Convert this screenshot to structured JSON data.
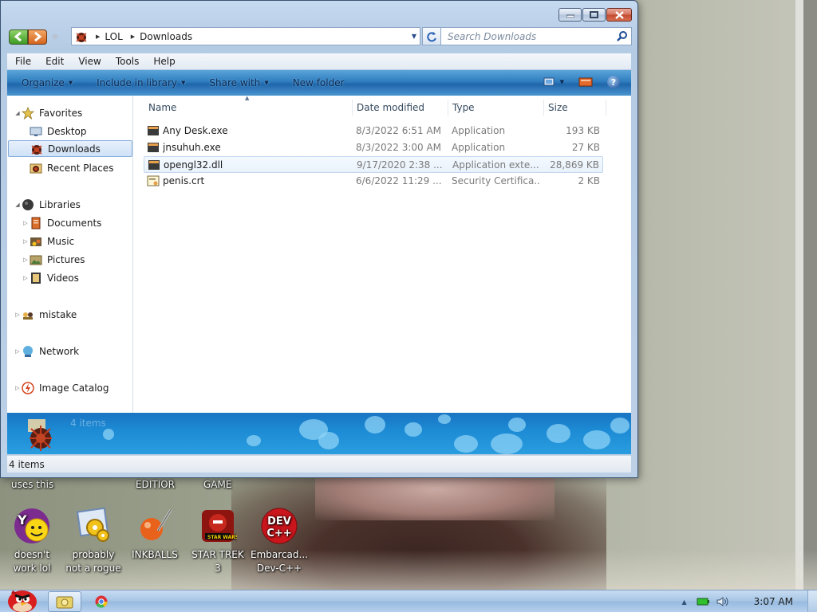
{
  "window": {
    "address": [
      "LOL",
      "Downloads"
    ],
    "search_placeholder": "Search Downloads",
    "menu": [
      "File",
      "Edit",
      "View",
      "Tools",
      "Help"
    ],
    "commands": [
      "Organize",
      "Include in library",
      "Share with",
      "New folder"
    ],
    "nav": {
      "favorites": "Favorites",
      "desktop": "Desktop",
      "downloads": "Downloads",
      "recent": "Recent Places",
      "libraries": "Libraries",
      "documents": "Documents",
      "music": "Music",
      "pictures": "Pictures",
      "videos": "Videos",
      "mistake": "mistake",
      "network": "Network",
      "image_catalog": "Image Catalog"
    },
    "columns": {
      "name": "Name",
      "date": "Date modified",
      "type": "Type",
      "size": "Size"
    },
    "files": [
      {
        "name": "Any Desk.exe",
        "date": "8/3/2022 6:51 AM",
        "type": "Application",
        "size": "193 KB"
      },
      {
        "name": "jnsuhuh.exe",
        "date": "8/3/2022 3:00 AM",
        "type": "Application",
        "size": "27 KB"
      },
      {
        "name": "opengl32.dll",
        "date": "9/17/2020 2:38 ...",
        "type": "Application exte...",
        "size": "28,869 KB"
      },
      {
        "name": "penis.crt",
        "date": "6/6/2022 11:29 ...",
        "type": "Security Certifica...",
        "size": "2 KB"
      }
    ],
    "details_count": "4 items",
    "status": "4 items"
  },
  "desktop": {
    "partial_labels": [
      "uses this",
      "EDITIOR",
      "GAME"
    ],
    "icons": [
      {
        "label_1": "doesn't",
        "label_2": "work lol",
        "icon": "yahoo-messenger-icon"
      },
      {
        "label_1": "probably",
        "label_2": "not a rogue",
        "icon": "gears-program-icon"
      },
      {
        "label_1": "INKBALLS",
        "label_2": "",
        "icon": "inkball-icon"
      },
      {
        "label_1": "STAR TREK",
        "label_2": "3",
        "icon": "star-wars-angry-birds-icon"
      },
      {
        "label_1": "Embarcad...",
        "label_2": "Dev-C++",
        "icon": "dev-cpp-icon"
      }
    ],
    "devcpp_badge_1": "DEV",
    "devcpp_badge_2": "C++"
  },
  "taskbar": {
    "clock": "3:07 AM"
  },
  "colors": {
    "command_bar": "#2f7dbf",
    "details_pane": "#1c8ad4",
    "taskbar": "#a9c7e6"
  }
}
